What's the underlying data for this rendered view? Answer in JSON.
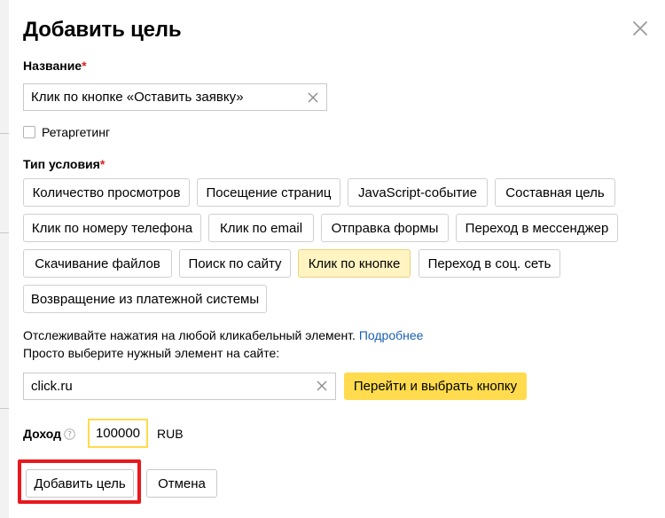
{
  "dialog": {
    "title": "Добавить цель",
    "name_label": "Название",
    "required_mark": "*",
    "name_value": "Клик по кнопке «Оставить заявку»",
    "retargeting_label": "Ретаргетинг",
    "condition_label": "Тип условия",
    "condition_types": [
      "Количество просмотров",
      "Посещение страниц",
      "JavaScript-событие",
      "Составная цель",
      "Клик по номеру телефона",
      "Клик по email",
      "Отправка формы",
      "Переход в мессенджер",
      "Скачивание файлов",
      "Поиск по сайту",
      "Клик по кнопке",
      "Переход в соц. сеть",
      "Возвращение из платежной системы"
    ],
    "selected_condition": "Клик по кнопке",
    "hint_line1": "Отслеживайте нажатия на любой кликабельный элемент.",
    "hint_link": "Подробнее",
    "hint_line2": "Просто выберите нужный элемент на сайте:",
    "site_value": "click.ru",
    "select_button_label": "Перейти и выбрать кнопку",
    "income_label": "Доход",
    "income_value": "100000",
    "currency": "RUB",
    "add_button_label": "Добавить цель",
    "cancel_button_label": "Отмена"
  },
  "icons": {
    "close": "close-icon",
    "clear": "clear-icon",
    "help": "help-icon"
  },
  "colors": {
    "accent_yellow": "#ffdb4d",
    "selected_chip": "#fff4c2",
    "required": "#e02020",
    "link": "#1a5fb4",
    "highlight_frame": "#e8191e"
  }
}
